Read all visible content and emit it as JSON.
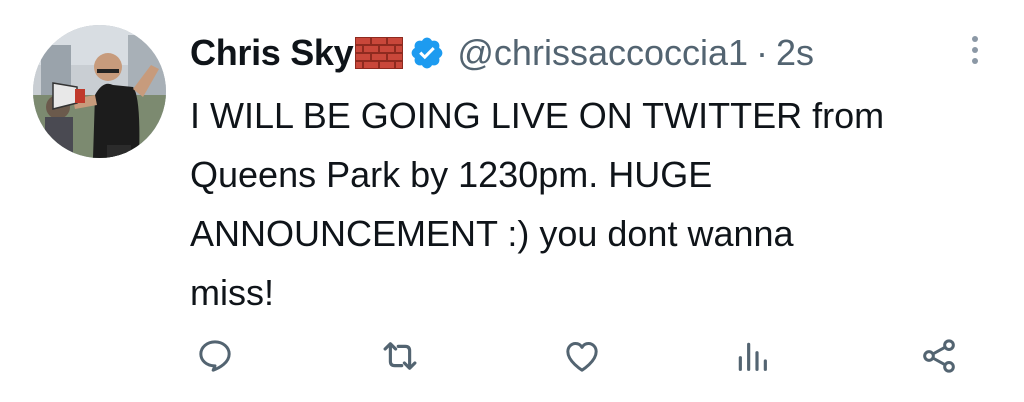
{
  "tweet": {
    "display_name": "Chris Sky",
    "name_emoji": "brick-icon",
    "verified_icon": "verified-badge-icon",
    "handle": "@chrissaccoccia1",
    "separator": "·",
    "time": "2s",
    "more_icon": "more-options-icon",
    "text": "I WILL BE GOING LIVE ON TWITTER from\nQueens Park by 1230pm. HUGE\nANNOUNCEMENT :) you dont wanna\nmiss!"
  },
  "actions": [
    {
      "name": "reply",
      "icon": "reply-icon"
    },
    {
      "name": "retweet",
      "icon": "retweet-icon"
    },
    {
      "name": "like",
      "icon": "heart-icon"
    },
    {
      "name": "views",
      "icon": "analytics-icon"
    },
    {
      "name": "share",
      "icon": "share-icon"
    }
  ],
  "colors": {
    "text": "#0f1419",
    "secondary": "#536471",
    "verified": "#1d9bf0",
    "brick": "#c0392b",
    "icon": "#536471"
  }
}
